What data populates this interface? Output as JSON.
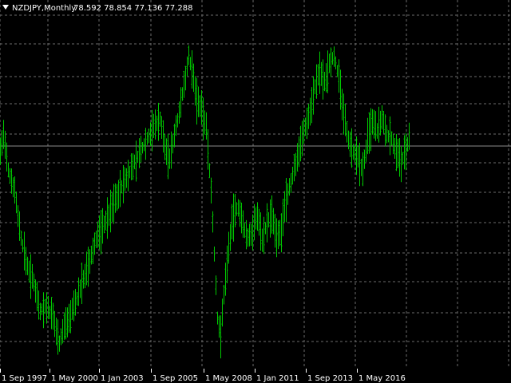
{
  "header": {
    "symbol_period": "NZDJPY,Monthly",
    "ohlc": "78.592 78.854 77.136 77.288",
    "arrow_icon": "triangle-down-icon"
  },
  "colors": {
    "background": "#000000",
    "bar": "#00c800",
    "grid": "#6b6b6b",
    "text": "#ffffff",
    "price_line": "#8c8c8c"
  },
  "chart_data": {
    "type": "line",
    "style": "ohlc-bars",
    "title": "",
    "xlabel": "",
    "ylabel": "",
    "x_tick_labels": [
      "1 Sep 1997",
      "1 May 2000",
      "1 Jan 2003",
      "1 Sep 2005",
      "1 May 2008",
      "1 Jan 2011",
      "1 Sep 2013",
      "1 May 2016"
    ],
    "y_tick_labels": [],
    "grid": true,
    "current_price": 77.288,
    "series": [
      {
        "x_start": "1997-01",
        "interval": "monthly",
        "close": [
          78.592
        ]
      }
    ]
  }
}
